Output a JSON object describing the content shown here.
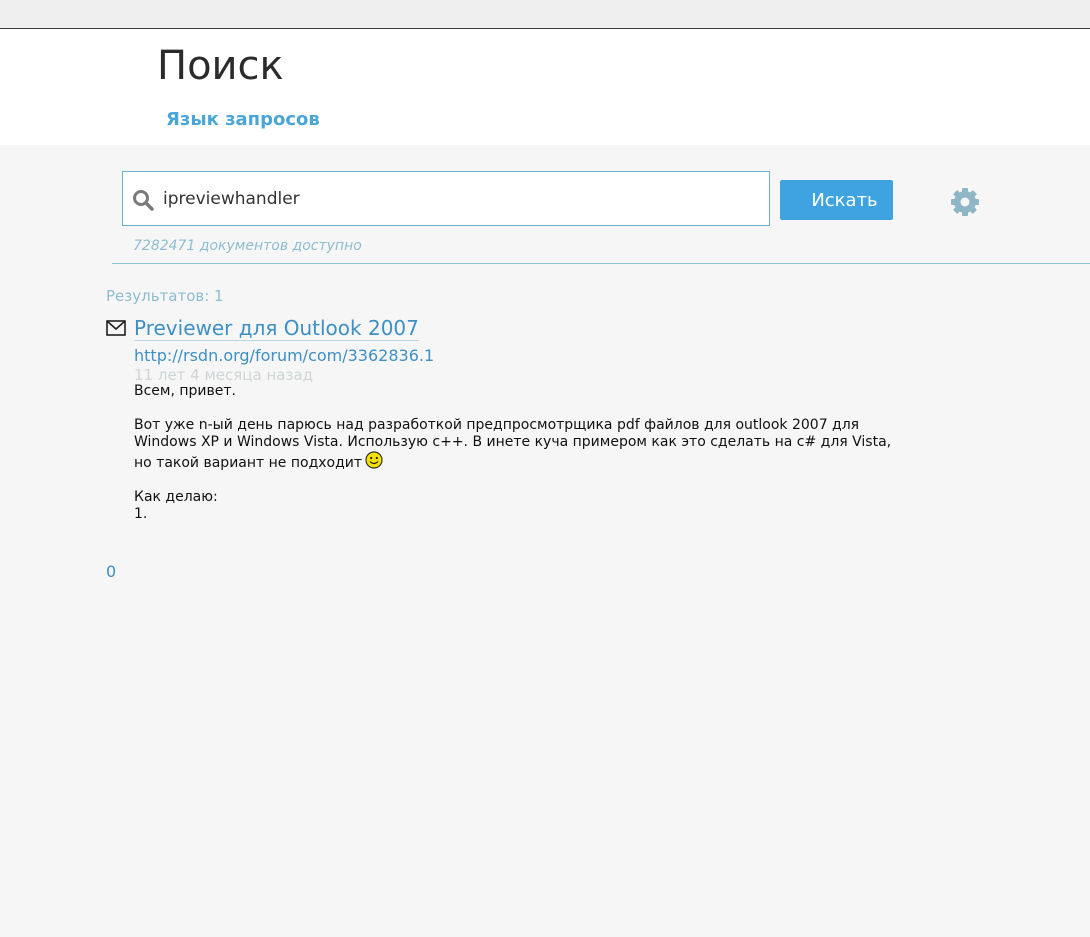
{
  "header": {
    "title": "Поиск",
    "query_language_link": "Язык запросов"
  },
  "search": {
    "query": "ipreviewhandler",
    "button_label": "Искать",
    "documents_available": "7282471 документов доступно"
  },
  "results": {
    "count_label": "Результатов: 1",
    "items": [
      {
        "title": "Previewer для Outlook 2007",
        "url": "http://rsdn.org/forum/com/3362836.1",
        "age": "11 лет 4 месяца назад",
        "snippet": {
          "line1": "Всем, привет.",
          "line2": "Вот уже n-ый день парюсь над разработкой предпросмотрщика pdf файлов для outlook 2007 для",
          "line3": "Windows XP и Windows Vista. Использую c++. В инете куча примером как это сделать на c# для Vista,",
          "line4": "но такой вариант не подходит",
          "line5": "Как делаю:",
          "line6": "1."
        }
      }
    ]
  },
  "pager": {
    "current": "0"
  },
  "colors": {
    "accent": "#3ea3e0",
    "link": "#3e8fc4",
    "muted": "#8dbdd0",
    "background": "#f6f6f6"
  },
  "icons": {
    "search": "search-icon",
    "settings": "gear-icon",
    "result_type": "envelope-icon",
    "emoticon": "smiley-icon"
  }
}
